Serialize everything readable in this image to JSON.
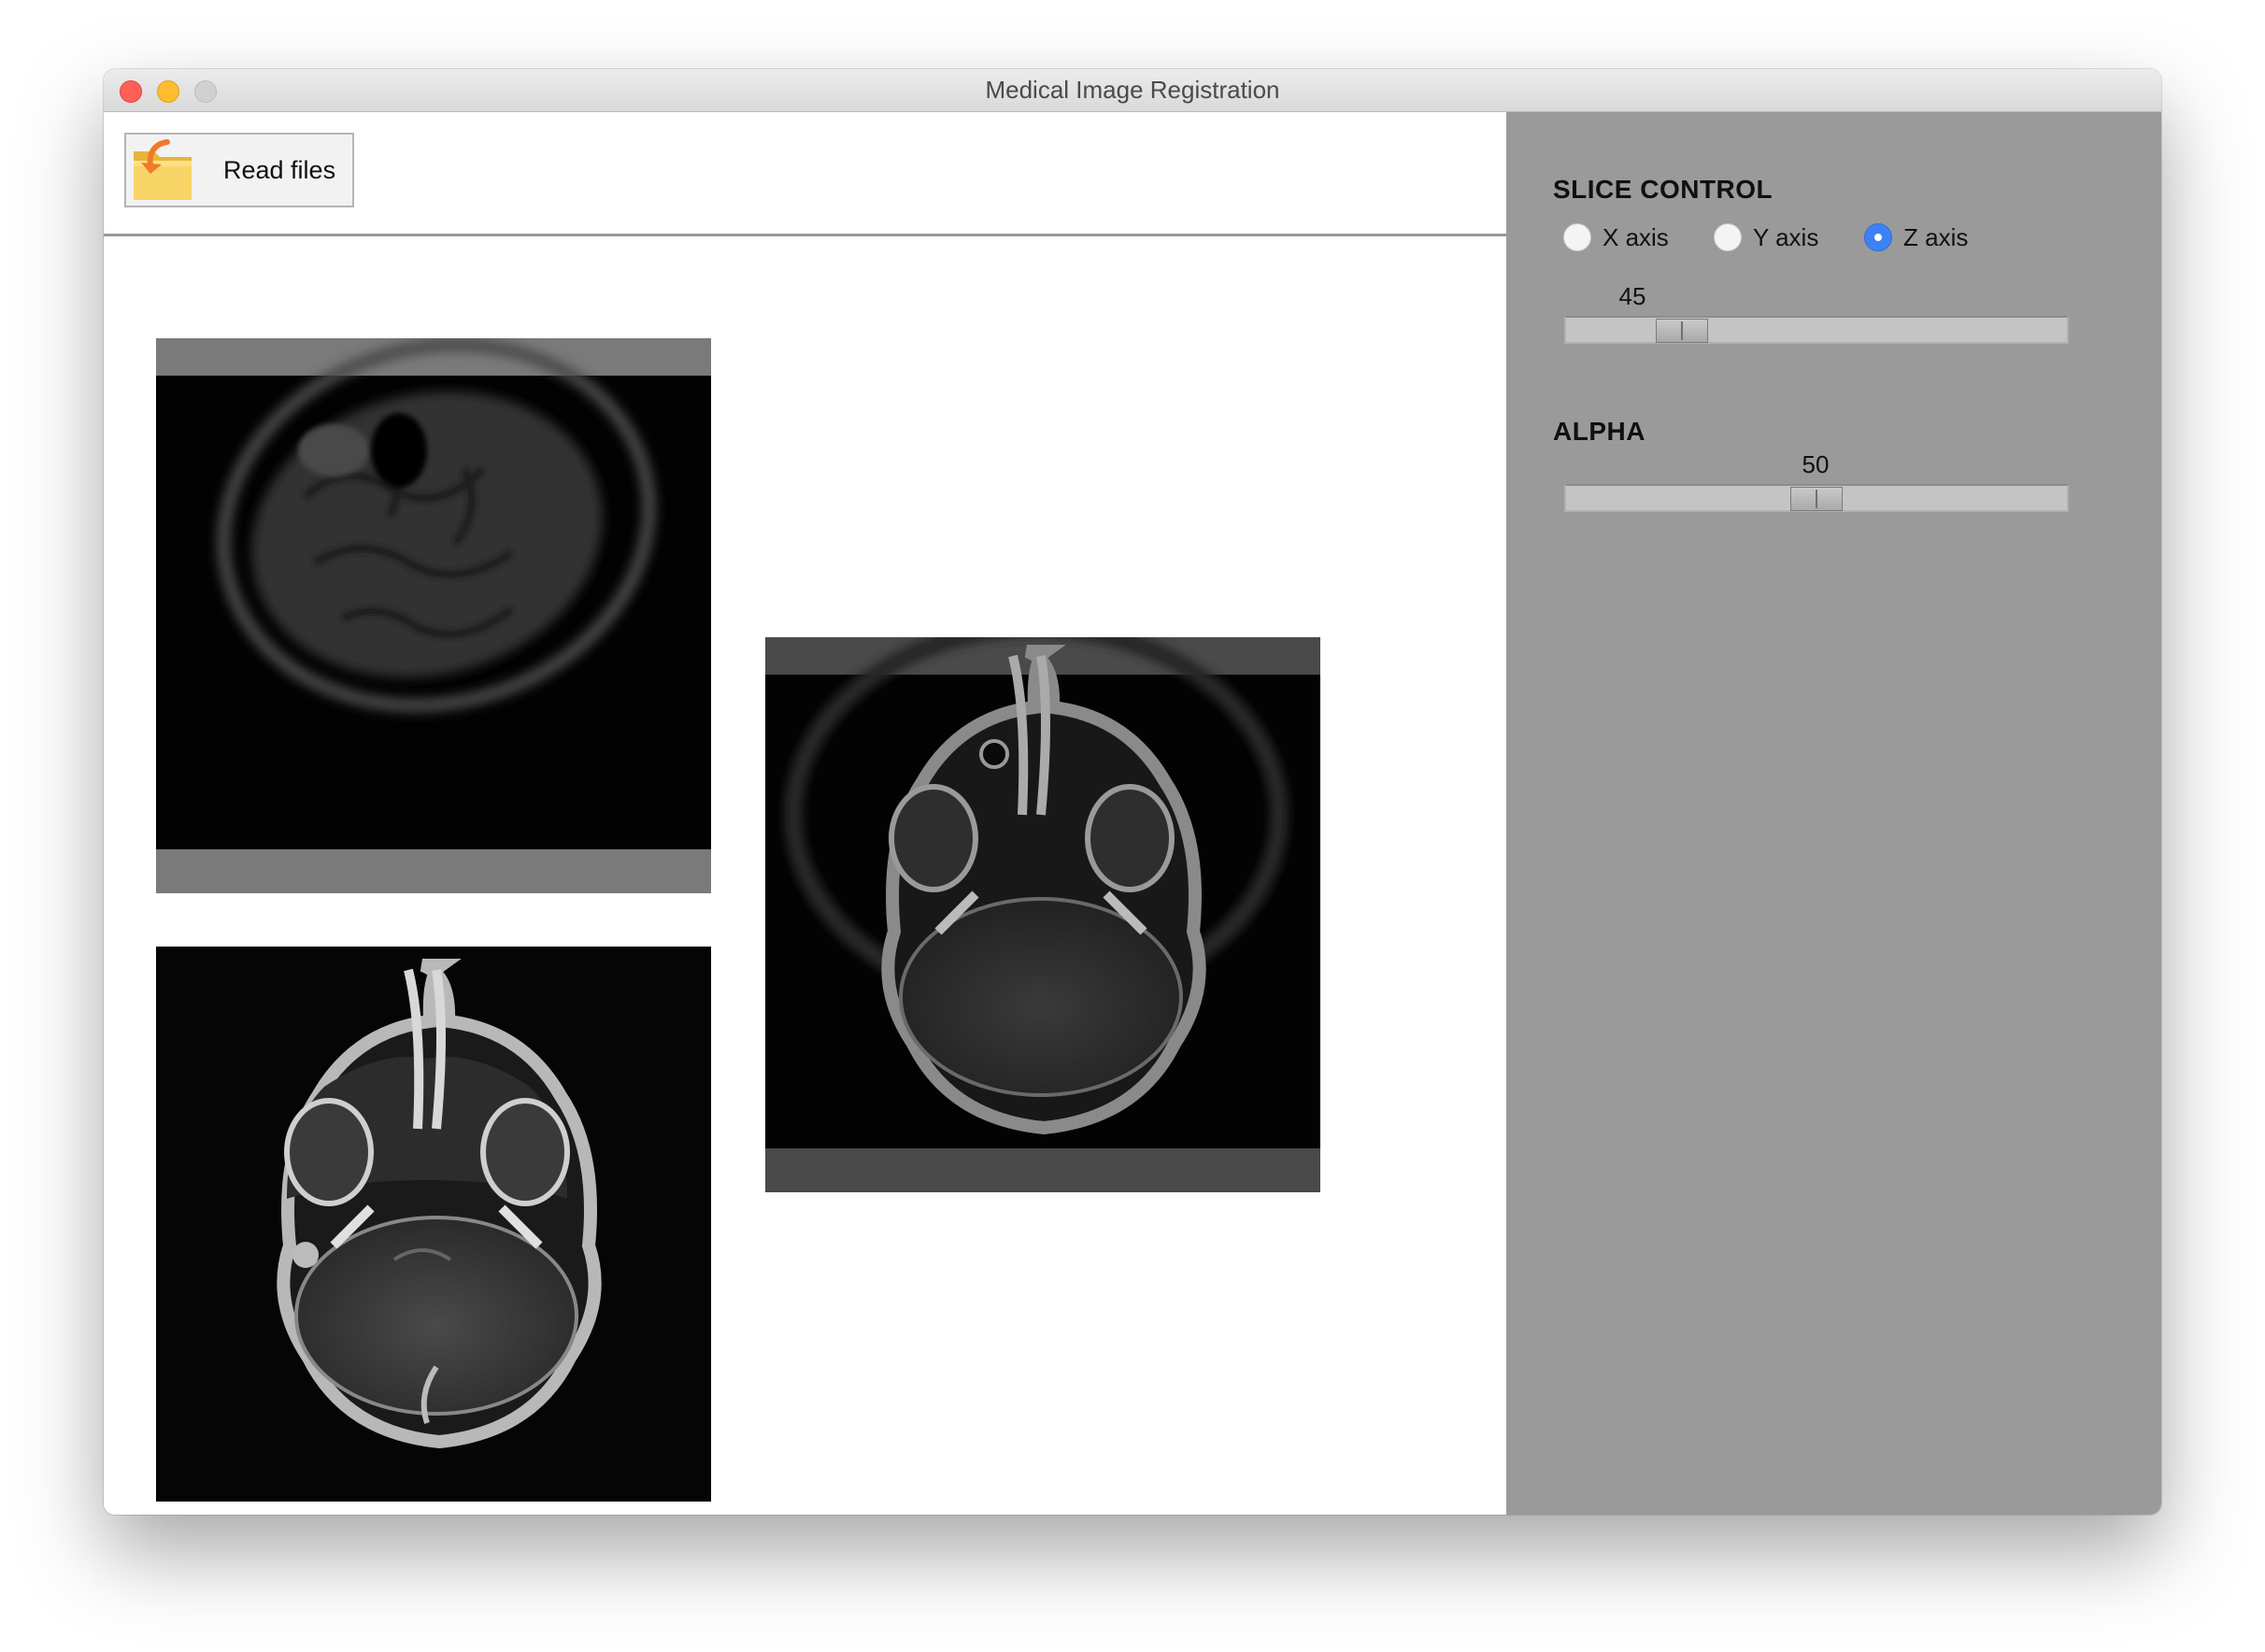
{
  "window": {
    "title": "Medical Image Registration"
  },
  "toolbar": {
    "read_files_label": "Read files"
  },
  "images": [
    {
      "name": "moving-image",
      "description_icon": "mri-brain-blurred"
    },
    {
      "name": "fixed-image",
      "description_icon": "mri-brain-axial"
    },
    {
      "name": "overlay-image",
      "description_icon": "mri-brain-overlay"
    }
  ],
  "panel": {
    "slice_control_title": "SLICE CONTROL",
    "axes": [
      {
        "label": "X axis",
        "checked": false
      },
      {
        "label": "Y axis",
        "checked": false
      },
      {
        "label": "Z axis",
        "checked": true
      }
    ],
    "slice_value": "45",
    "slice_fraction": 0.2,
    "alpha_title": "ALPHA",
    "alpha_value": "50",
    "alpha_fraction": 0.5
  },
  "colors": {
    "panel_bg": "#9a9a9a",
    "radio_checked": "#3b82f6",
    "folder": "#f7c84a",
    "arrow": "#f07a2a"
  }
}
